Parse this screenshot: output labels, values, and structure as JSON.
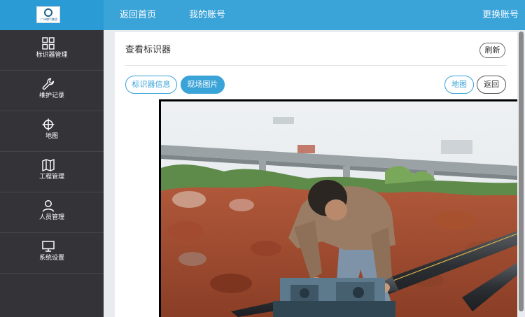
{
  "topbar": {
    "logo_text": "广州燃气集团",
    "home_label": "返回首页",
    "account_label": "我的账号",
    "switch_label": "更换账号"
  },
  "sidebar": {
    "items": [
      {
        "label": "标识器管理",
        "icon": "grid-icon"
      },
      {
        "label": "维护记录",
        "icon": "wrench-icon"
      },
      {
        "label": "地图",
        "icon": "crosshair-icon"
      },
      {
        "label": "工程管理",
        "icon": "map-icon"
      },
      {
        "label": "人员管理",
        "icon": "user-icon"
      },
      {
        "label": "系统设置",
        "icon": "monitor-icon"
      }
    ]
  },
  "content": {
    "title": "查看标识器",
    "refresh_label": "刷新",
    "tabs": [
      {
        "label": "标识器信息",
        "active": false
      },
      {
        "label": "现场图片",
        "active": true
      }
    ],
    "map_label": "地图",
    "back_label": "返回"
  },
  "colors": {
    "accent": "#3aa3d8",
    "sidebar_bg": "#333338",
    "page_bg": "#e9ecef"
  }
}
